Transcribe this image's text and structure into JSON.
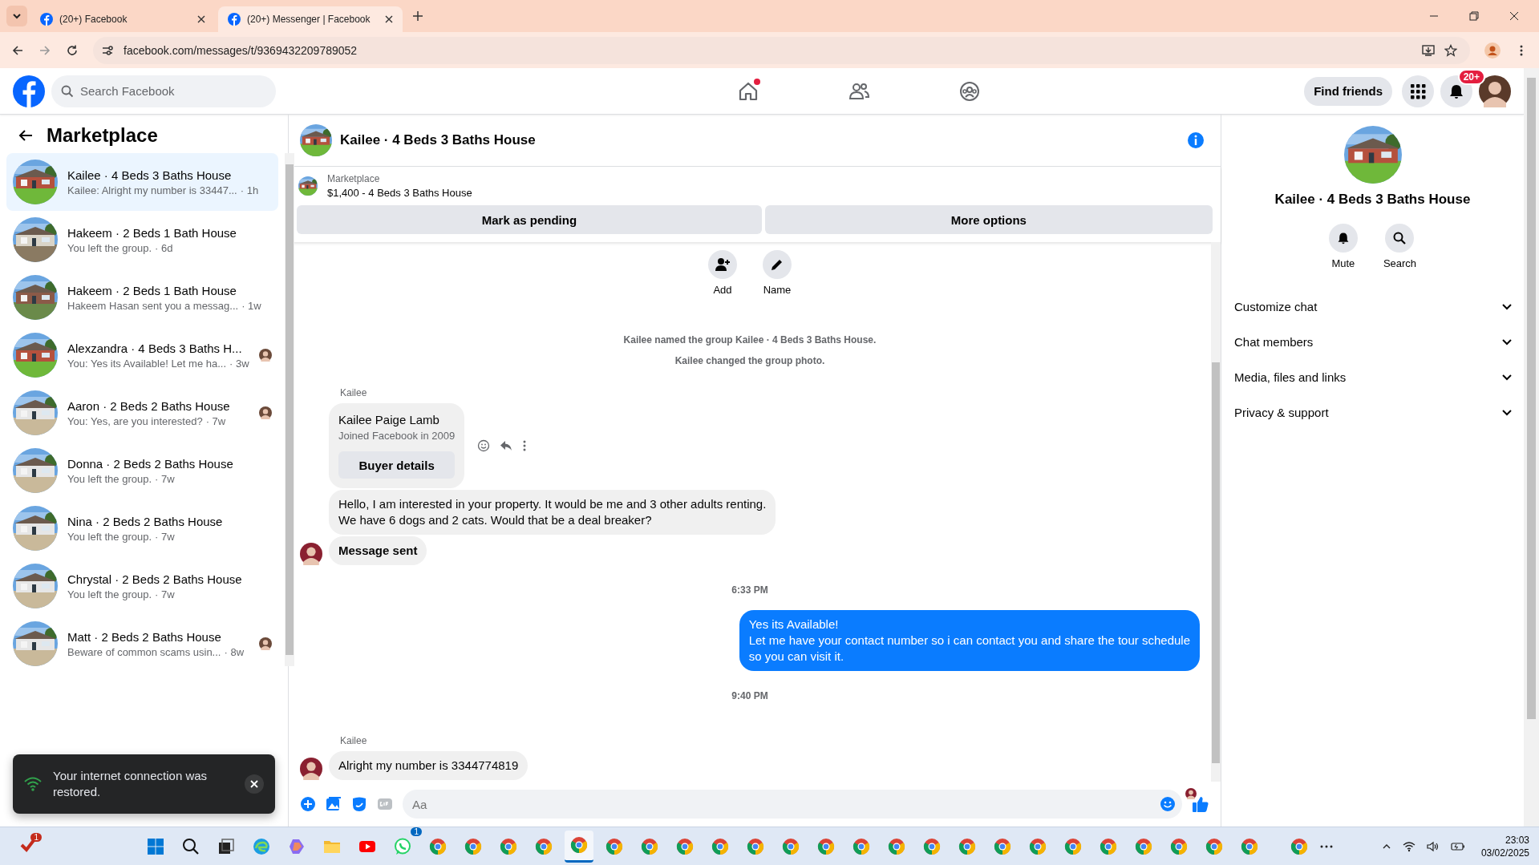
{
  "browser": {
    "tabs": [
      {
        "title": "(20+) Facebook",
        "selected": false
      },
      {
        "title": "(20+) Messenger | Facebook",
        "selected": true
      }
    ],
    "url": "facebook.com/messages/t/9369432209789052"
  },
  "topbar": {
    "search_placeholder": "Search Facebook",
    "nav": [
      {
        "kind": "home",
        "dot": true
      },
      {
        "kind": "friends",
        "dot": false
      },
      {
        "kind": "groups",
        "dot": false
      }
    ],
    "find_friends": "Find friends",
    "notification_badge": "20+"
  },
  "sidebar": {
    "title": "Marketplace",
    "items": [
      {
        "title": "Kailee · 4 Beds 3 Baths House",
        "preview": "Kailee: Alright my number is 33447...",
        "time": "· 1h",
        "selected": true,
        "seen": false
      },
      {
        "title": "Hakeem · 2 Beds 1 Bath House",
        "preview": "You left the group.",
        "time": "· 6d",
        "selected": false,
        "seen": false
      },
      {
        "title": "Hakeem · 2 Beds 1 Bath House",
        "preview": "Hakeem Hasan sent you a messag...",
        "time": "· 1w",
        "selected": false,
        "seen": false
      },
      {
        "title": "Alexzandra · 4 Beds 3 Baths H...",
        "preview": "You: Yes its Available! Let me ha...",
        "time": "· 3w",
        "selected": false,
        "seen": true
      },
      {
        "title": "Aaron · 2 Beds 2 Baths House",
        "preview": "You: Yes, are you interested?",
        "time": "· 7w",
        "selected": false,
        "seen": true
      },
      {
        "title": "Donna · 2 Beds 2 Baths House",
        "preview": "You left the group.",
        "time": "· 7w",
        "selected": false,
        "seen": false
      },
      {
        "title": "Nina · 2 Beds 2 Baths House",
        "preview": "You left the group.",
        "time": "· 7w",
        "selected": false,
        "seen": false
      },
      {
        "title": "Chrystal · 2 Beds 2 Baths House",
        "preview": "You left the group.",
        "time": "· 7w",
        "selected": false,
        "seen": false
      },
      {
        "title": "Matt · 2 Beds 2 Baths House",
        "preview": "Beware of common scams usin...",
        "time": "· 8w",
        "selected": false,
        "seen": true
      }
    ]
  },
  "chat": {
    "title": "Kailee · 4 Beds 3 Baths House",
    "listing": {
      "label": "Marketplace",
      "price": "$1,400 - 4 Beds 3 Baths House"
    },
    "buttons": [
      "Mark as pending",
      "More options"
    ],
    "actions": [
      {
        "kind": "add",
        "label": "Add"
      },
      {
        "kind": "name",
        "label": "Name"
      }
    ],
    "messages": [
      {
        "kind": "system",
        "text": "Kailee named the group Kailee · 4 Beds 3 Baths House."
      },
      {
        "kind": "system",
        "text": "Kailee changed the group photo."
      },
      {
        "kind": "sender",
        "text": "Kailee"
      },
      {
        "kind": "profile_card",
        "name": "Kailee Paige Lamb",
        "subtitle": "Joined Facebook in 2009",
        "button": "Buyer details"
      },
      {
        "kind": "incoming",
        "text": "Hello, I am interested in your property. It would be me and 3 other adults renting.\nWe have 6 dogs and 2 cats. Would that be a deal breaker?",
        "bold": false,
        "avatar": false
      },
      {
        "kind": "incoming",
        "text": "Message sent",
        "bold": true,
        "avatar": true
      },
      {
        "kind": "time",
        "text": "6:33 PM"
      },
      {
        "kind": "outgoing",
        "text": "Yes its Available!\nLet me have your contact number so i can contact you and share the tour schedule\nso you can visit it."
      },
      {
        "kind": "time",
        "text": "9:40 PM"
      },
      {
        "kind": "sender",
        "text": "Kailee"
      },
      {
        "kind": "incoming",
        "text": "Alright my number is 3344774819",
        "bold": false,
        "avatar": true
      }
    ],
    "composer_placeholder": "Aa"
  },
  "details": {
    "title": "Kailee · 4 Beds 3 Baths House",
    "actions": [
      {
        "kind": "mute",
        "label": "Mute"
      },
      {
        "kind": "search",
        "label": "Search"
      }
    ],
    "sections": [
      {
        "label": "Customize chat",
        "expanded": false
      },
      {
        "label": "Chat members",
        "expanded": false
      },
      {
        "label": "Media, files and links",
        "expanded": false
      },
      {
        "label": "Privacy & support",
        "expanded": false
      }
    ]
  },
  "toast": {
    "text": "Your internet connection was restored."
  },
  "taskbar": {
    "apps": [
      {
        "kind": "start",
        "selected": false
      },
      {
        "kind": "search",
        "selected": false
      },
      {
        "kind": "taskview",
        "selected": false
      },
      {
        "kind": "edge",
        "selected": false
      },
      {
        "kind": "copilot",
        "selected": false
      },
      {
        "kind": "files",
        "selected": false
      },
      {
        "kind": "youtube",
        "selected": false
      },
      {
        "kind": "whatsapp",
        "selected": false,
        "badge": "1"
      },
      {
        "kind": "chrome",
        "selected": false
      },
      {
        "kind": "chrome",
        "selected": false
      },
      {
        "kind": "chrome",
        "selected": false
      },
      {
        "kind": "chrome",
        "selected": false
      },
      {
        "kind": "chrome",
        "selected": true
      },
      {
        "kind": "chrome",
        "selected": false
      },
      {
        "kind": "chrome",
        "selected": false
      },
      {
        "kind": "chrome",
        "selected": false
      },
      {
        "kind": "chrome",
        "selected": false
      },
      {
        "kind": "chrome",
        "selected": false
      },
      {
        "kind": "chrome",
        "selected": false
      },
      {
        "kind": "chrome",
        "selected": false
      },
      {
        "kind": "chrome",
        "selected": false
      },
      {
        "kind": "chrome",
        "selected": false
      },
      {
        "kind": "chrome",
        "selected": false
      },
      {
        "kind": "chrome",
        "selected": false
      },
      {
        "kind": "chrome",
        "selected": false
      },
      {
        "kind": "chrome",
        "selected": false
      },
      {
        "kind": "chrome",
        "selected": false
      },
      {
        "kind": "chrome",
        "selected": false
      },
      {
        "kind": "chrome",
        "selected": false
      },
      {
        "kind": "chrome",
        "selected": false
      },
      {
        "kind": "chrome",
        "selected": false
      },
      {
        "kind": "chrome",
        "selected": false
      },
      {
        "kind": "chrome",
        "selected": false
      }
    ],
    "widget_badge": "1",
    "time": "23:03",
    "date": "03/02/2025"
  }
}
